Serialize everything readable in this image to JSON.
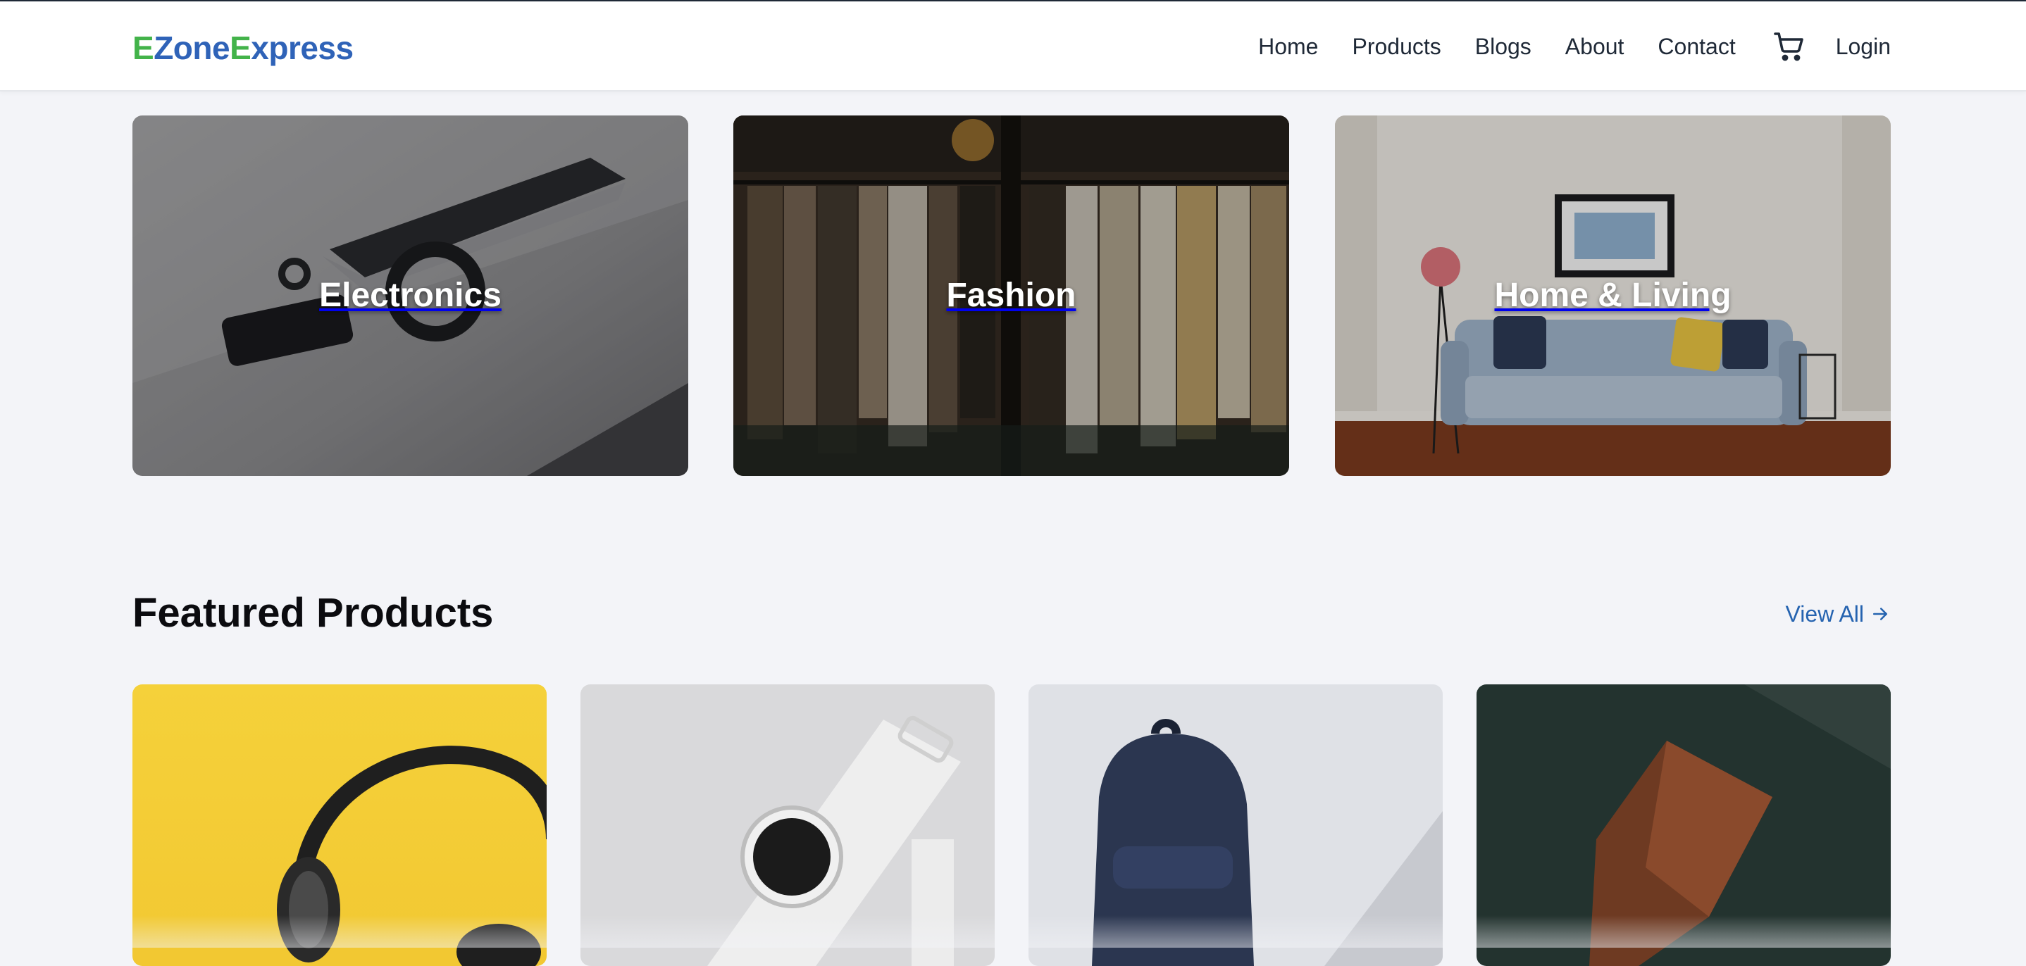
{
  "brand": {
    "name_part1_initial": "E",
    "name_part1_rest": "Zone ",
    "name_part2_initial": "E",
    "name_part2_rest": "xpress",
    "colors": {
      "blue": "#2f63b8",
      "green": "#43b34a"
    }
  },
  "nav": {
    "items": [
      "Home",
      "Products",
      "Blogs",
      "About",
      "Contact"
    ],
    "cart_icon": "cart-icon",
    "login": "Login"
  },
  "categories": [
    {
      "label": "Electronics"
    },
    {
      "label": "Fashion"
    },
    {
      "label": "Home & Living"
    }
  ],
  "featured": {
    "title": "Featured Products",
    "view_all": "View All",
    "view_all_icon": "arrow-right-icon",
    "link_color": "#2563b0",
    "products": [
      {
        "image": "headphones-image"
      },
      {
        "image": "watch-image"
      },
      {
        "image": "backpack-image"
      },
      {
        "image": "wallet-image"
      }
    ]
  }
}
